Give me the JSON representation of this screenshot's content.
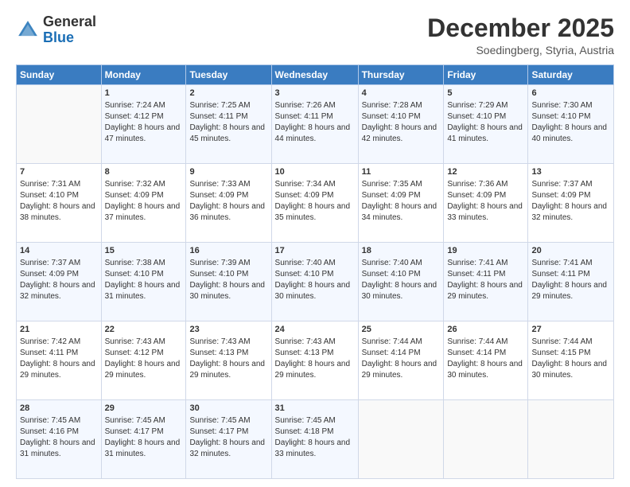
{
  "header": {
    "logo_general": "General",
    "logo_blue": "Blue",
    "month": "December 2025",
    "location": "Soedingberg, Styria, Austria"
  },
  "weekdays": [
    "Sunday",
    "Monday",
    "Tuesday",
    "Wednesday",
    "Thursday",
    "Friday",
    "Saturday"
  ],
  "weeks": [
    [
      {
        "day": "",
        "sunrise": "",
        "sunset": "",
        "daylight": ""
      },
      {
        "day": "1",
        "sunrise": "Sunrise: 7:24 AM",
        "sunset": "Sunset: 4:12 PM",
        "daylight": "Daylight: 8 hours and 47 minutes."
      },
      {
        "day": "2",
        "sunrise": "Sunrise: 7:25 AM",
        "sunset": "Sunset: 4:11 PM",
        "daylight": "Daylight: 8 hours and 45 minutes."
      },
      {
        "day": "3",
        "sunrise": "Sunrise: 7:26 AM",
        "sunset": "Sunset: 4:11 PM",
        "daylight": "Daylight: 8 hours and 44 minutes."
      },
      {
        "day": "4",
        "sunrise": "Sunrise: 7:28 AM",
        "sunset": "Sunset: 4:10 PM",
        "daylight": "Daylight: 8 hours and 42 minutes."
      },
      {
        "day": "5",
        "sunrise": "Sunrise: 7:29 AM",
        "sunset": "Sunset: 4:10 PM",
        "daylight": "Daylight: 8 hours and 41 minutes."
      },
      {
        "day": "6",
        "sunrise": "Sunrise: 7:30 AM",
        "sunset": "Sunset: 4:10 PM",
        "daylight": "Daylight: 8 hours and 40 minutes."
      }
    ],
    [
      {
        "day": "7",
        "sunrise": "Sunrise: 7:31 AM",
        "sunset": "Sunset: 4:10 PM",
        "daylight": "Daylight: 8 hours and 38 minutes."
      },
      {
        "day": "8",
        "sunrise": "Sunrise: 7:32 AM",
        "sunset": "Sunset: 4:09 PM",
        "daylight": "Daylight: 8 hours and 37 minutes."
      },
      {
        "day": "9",
        "sunrise": "Sunrise: 7:33 AM",
        "sunset": "Sunset: 4:09 PM",
        "daylight": "Daylight: 8 hours and 36 minutes."
      },
      {
        "day": "10",
        "sunrise": "Sunrise: 7:34 AM",
        "sunset": "Sunset: 4:09 PM",
        "daylight": "Daylight: 8 hours and 35 minutes."
      },
      {
        "day": "11",
        "sunrise": "Sunrise: 7:35 AM",
        "sunset": "Sunset: 4:09 PM",
        "daylight": "Daylight: 8 hours and 34 minutes."
      },
      {
        "day": "12",
        "sunrise": "Sunrise: 7:36 AM",
        "sunset": "Sunset: 4:09 PM",
        "daylight": "Daylight: 8 hours and 33 minutes."
      },
      {
        "day": "13",
        "sunrise": "Sunrise: 7:37 AM",
        "sunset": "Sunset: 4:09 PM",
        "daylight": "Daylight: 8 hours and 32 minutes."
      }
    ],
    [
      {
        "day": "14",
        "sunrise": "Sunrise: 7:37 AM",
        "sunset": "Sunset: 4:09 PM",
        "daylight": "Daylight: 8 hours and 32 minutes."
      },
      {
        "day": "15",
        "sunrise": "Sunrise: 7:38 AM",
        "sunset": "Sunset: 4:10 PM",
        "daylight": "Daylight: 8 hours and 31 minutes."
      },
      {
        "day": "16",
        "sunrise": "Sunrise: 7:39 AM",
        "sunset": "Sunset: 4:10 PM",
        "daylight": "Daylight: 8 hours and 30 minutes."
      },
      {
        "day": "17",
        "sunrise": "Sunrise: 7:40 AM",
        "sunset": "Sunset: 4:10 PM",
        "daylight": "Daylight: 8 hours and 30 minutes."
      },
      {
        "day": "18",
        "sunrise": "Sunrise: 7:40 AM",
        "sunset": "Sunset: 4:10 PM",
        "daylight": "Daylight: 8 hours and 30 minutes."
      },
      {
        "day": "19",
        "sunrise": "Sunrise: 7:41 AM",
        "sunset": "Sunset: 4:11 PM",
        "daylight": "Daylight: 8 hours and 29 minutes."
      },
      {
        "day": "20",
        "sunrise": "Sunrise: 7:41 AM",
        "sunset": "Sunset: 4:11 PM",
        "daylight": "Daylight: 8 hours and 29 minutes."
      }
    ],
    [
      {
        "day": "21",
        "sunrise": "Sunrise: 7:42 AM",
        "sunset": "Sunset: 4:11 PM",
        "daylight": "Daylight: 8 hours and 29 minutes."
      },
      {
        "day": "22",
        "sunrise": "Sunrise: 7:43 AM",
        "sunset": "Sunset: 4:12 PM",
        "daylight": "Daylight: 8 hours and 29 minutes."
      },
      {
        "day": "23",
        "sunrise": "Sunrise: 7:43 AM",
        "sunset": "Sunset: 4:13 PM",
        "daylight": "Daylight: 8 hours and 29 minutes."
      },
      {
        "day": "24",
        "sunrise": "Sunrise: 7:43 AM",
        "sunset": "Sunset: 4:13 PM",
        "daylight": "Daylight: 8 hours and 29 minutes."
      },
      {
        "day": "25",
        "sunrise": "Sunrise: 7:44 AM",
        "sunset": "Sunset: 4:14 PM",
        "daylight": "Daylight: 8 hours and 29 minutes."
      },
      {
        "day": "26",
        "sunrise": "Sunrise: 7:44 AM",
        "sunset": "Sunset: 4:14 PM",
        "daylight": "Daylight: 8 hours and 30 minutes."
      },
      {
        "day": "27",
        "sunrise": "Sunrise: 7:44 AM",
        "sunset": "Sunset: 4:15 PM",
        "daylight": "Daylight: 8 hours and 30 minutes."
      }
    ],
    [
      {
        "day": "28",
        "sunrise": "Sunrise: 7:45 AM",
        "sunset": "Sunset: 4:16 PM",
        "daylight": "Daylight: 8 hours and 31 minutes."
      },
      {
        "day": "29",
        "sunrise": "Sunrise: 7:45 AM",
        "sunset": "Sunset: 4:17 PM",
        "daylight": "Daylight: 8 hours and 31 minutes."
      },
      {
        "day": "30",
        "sunrise": "Sunrise: 7:45 AM",
        "sunset": "Sunset: 4:17 PM",
        "daylight": "Daylight: 8 hours and 32 minutes."
      },
      {
        "day": "31",
        "sunrise": "Sunrise: 7:45 AM",
        "sunset": "Sunset: 4:18 PM",
        "daylight": "Daylight: 8 hours and 33 minutes."
      },
      {
        "day": "",
        "sunrise": "",
        "sunset": "",
        "daylight": ""
      },
      {
        "day": "",
        "sunrise": "",
        "sunset": "",
        "daylight": ""
      },
      {
        "day": "",
        "sunrise": "",
        "sunset": "",
        "daylight": ""
      }
    ]
  ]
}
